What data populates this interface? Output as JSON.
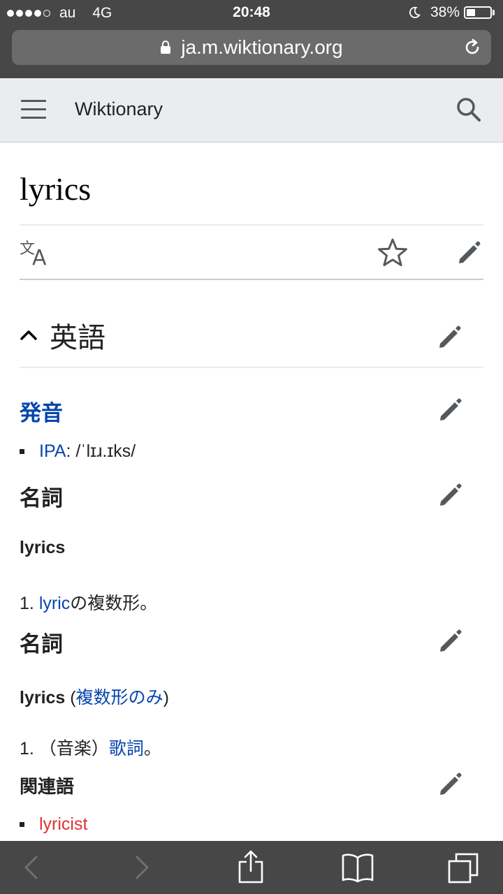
{
  "status_bar": {
    "carrier": "au",
    "network": "4G",
    "time": "20:48",
    "battery": "38%",
    "battery_level": 0.38,
    "signal_bars": 4
  },
  "browser": {
    "url": "ja.m.wiktionary.org"
  },
  "site": {
    "title": "Wiktionary"
  },
  "page": {
    "title": "lyrics",
    "section_title": "英語",
    "pronunciation": {
      "heading": "発音",
      "ipa_label": "IPA",
      "ipa_value": ": /ˈlɪɹ.ɪks/"
    },
    "noun1": {
      "heading": "名詞",
      "headword": "lyrics",
      "def_number": "1.",
      "def_link": "lyric",
      "def_text": "の複数形。"
    },
    "noun2": {
      "heading": "名詞",
      "headword": "lyrics",
      "paren_open": " (",
      "qualifier": "複数形のみ",
      "paren_close": ")",
      "def_number": "1.",
      "def_prefix": "（音楽）",
      "def_link": "歌詞",
      "def_suffix": "。"
    },
    "related": {
      "heading": "関連語",
      "item": "lyricist"
    }
  },
  "colors": {
    "link": "#0645ad",
    "redlink": "#dd3333",
    "header_bg": "#eaecf0",
    "chrome_bg": "#474747"
  }
}
